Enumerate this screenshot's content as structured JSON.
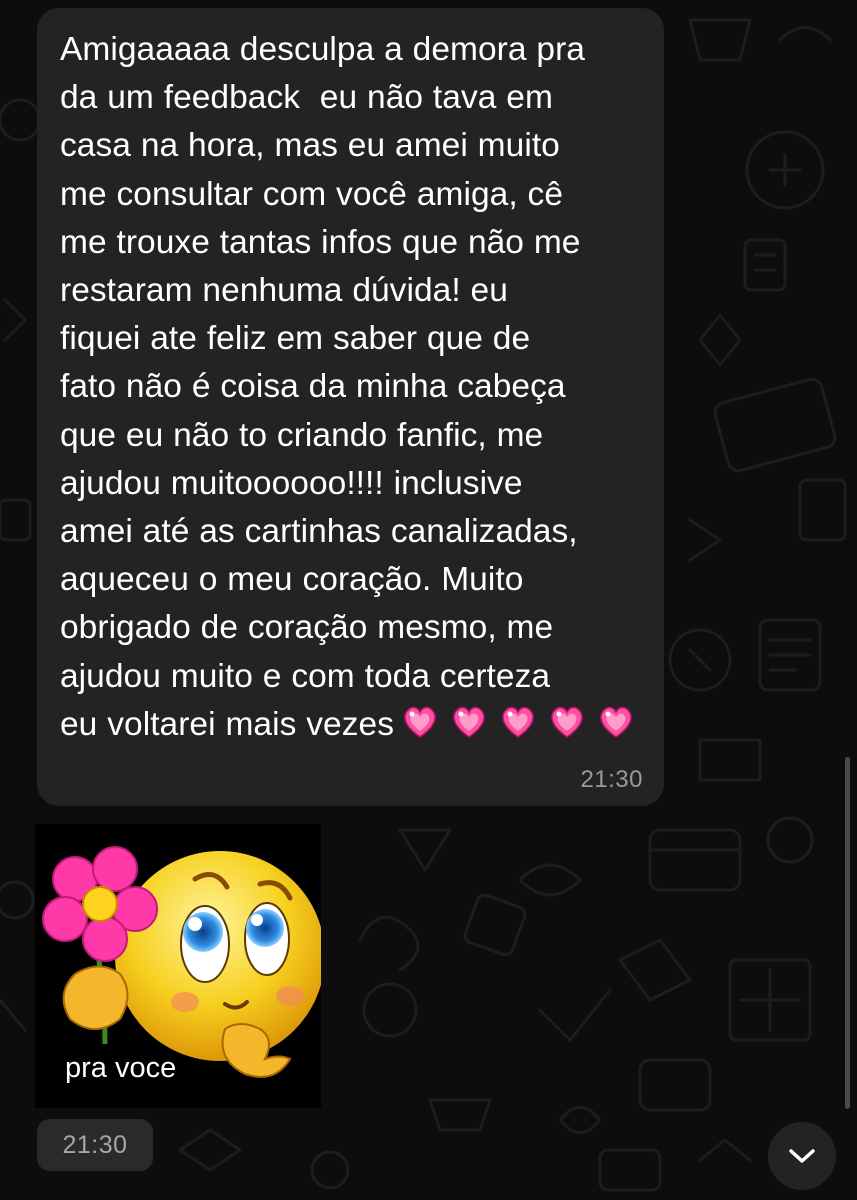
{
  "messages": [
    {
      "text": "Amigaaaaa desculpa a demora pra\nda um feedback  eu não tava em\ncasa na hora, mas eu amei muito\nme consultar com você amiga, cê\nme trouxe tantas infos que não me\nrestaram nenhuma dúvida! eu\nfiquei ate feliz em saber que de\nfato não é coisa da minha cabeça\nque eu não to criando fanfic, me\najudou muitoooooo!!!! inclusive\namei até as cartinhas canalizadas,\naqueceu o meu coração. Muito\nobrigado de coração mesmo, me\najudou muito e com toda certeza\neu voltarei mais vezes",
      "emoji_icon": "sparkling-heart-icon",
      "emoji_count": 5,
      "time": "21:30"
    }
  ],
  "sticker": {
    "caption": "pra voce",
    "icon": "smiley-with-flower-icon",
    "time": "21:30"
  },
  "colors": {
    "background": "#0d0d0d",
    "bubble": "#232323",
    "text": "#ffffff",
    "timestamp": "#9a9a9a",
    "heart": "#ff4fa0"
  },
  "controls": {
    "scroll_down_icon": "chevron-down-icon"
  }
}
